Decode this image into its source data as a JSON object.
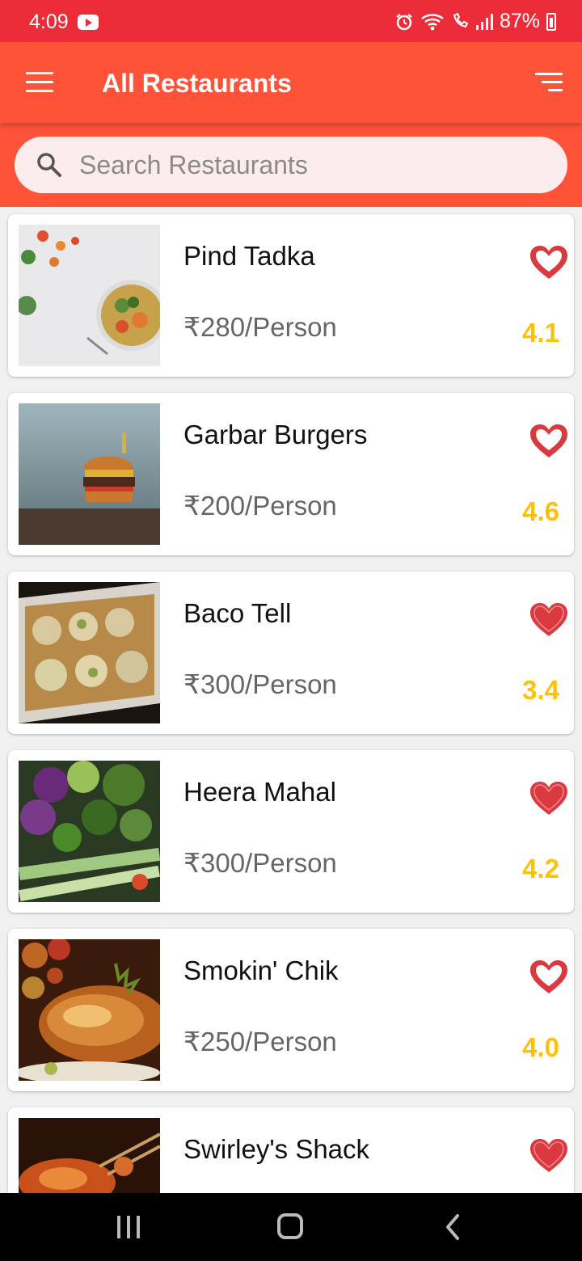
{
  "status_bar": {
    "time": "4:09",
    "battery": "87%",
    "icons": [
      "youtube-icon",
      "alarm-icon",
      "wifi-icon",
      "wifi-calling-icon",
      "signal-icon",
      "battery-icon"
    ]
  },
  "app_bar": {
    "title": "All Restaurants",
    "menu_icon": "menu-icon",
    "sort_icon": "sort-icon",
    "color": "#fe5339"
  },
  "search": {
    "placeholder": "Search Restaurants",
    "value": ""
  },
  "restaurants": [
    {
      "name": "Pind Tadka",
      "price": "₹280/Person",
      "rating": "4.1",
      "favorite": false,
      "image": "salad-bowl"
    },
    {
      "name": "Garbar Burgers",
      "price": "₹200/Person",
      "rating": "4.6",
      "favorite": false,
      "image": "burger"
    },
    {
      "name": "Baco Tell",
      "price": "₹300/Person",
      "rating": "3.4",
      "favorite": true,
      "image": "tacos"
    },
    {
      "name": "Heera Mahal",
      "price": "₹300/Person",
      "rating": "4.2",
      "favorite": true,
      "image": "vegetables"
    },
    {
      "name": "Smokin' Chik",
      "price": "₹250/Person",
      "rating": "4.0",
      "favorite": false,
      "image": "roast-chicken"
    },
    {
      "name": "Swirley's Shack",
      "price": "",
      "rating": "",
      "favorite": true,
      "image": "skewers"
    }
  ],
  "colors": {
    "status_bar": "#ed2c3a",
    "accent": "#fe5339",
    "rating": "#ffc107",
    "heart": "#d9393f"
  },
  "nav_bar": {
    "icons": [
      "recents-icon",
      "home-icon",
      "back-icon"
    ]
  }
}
